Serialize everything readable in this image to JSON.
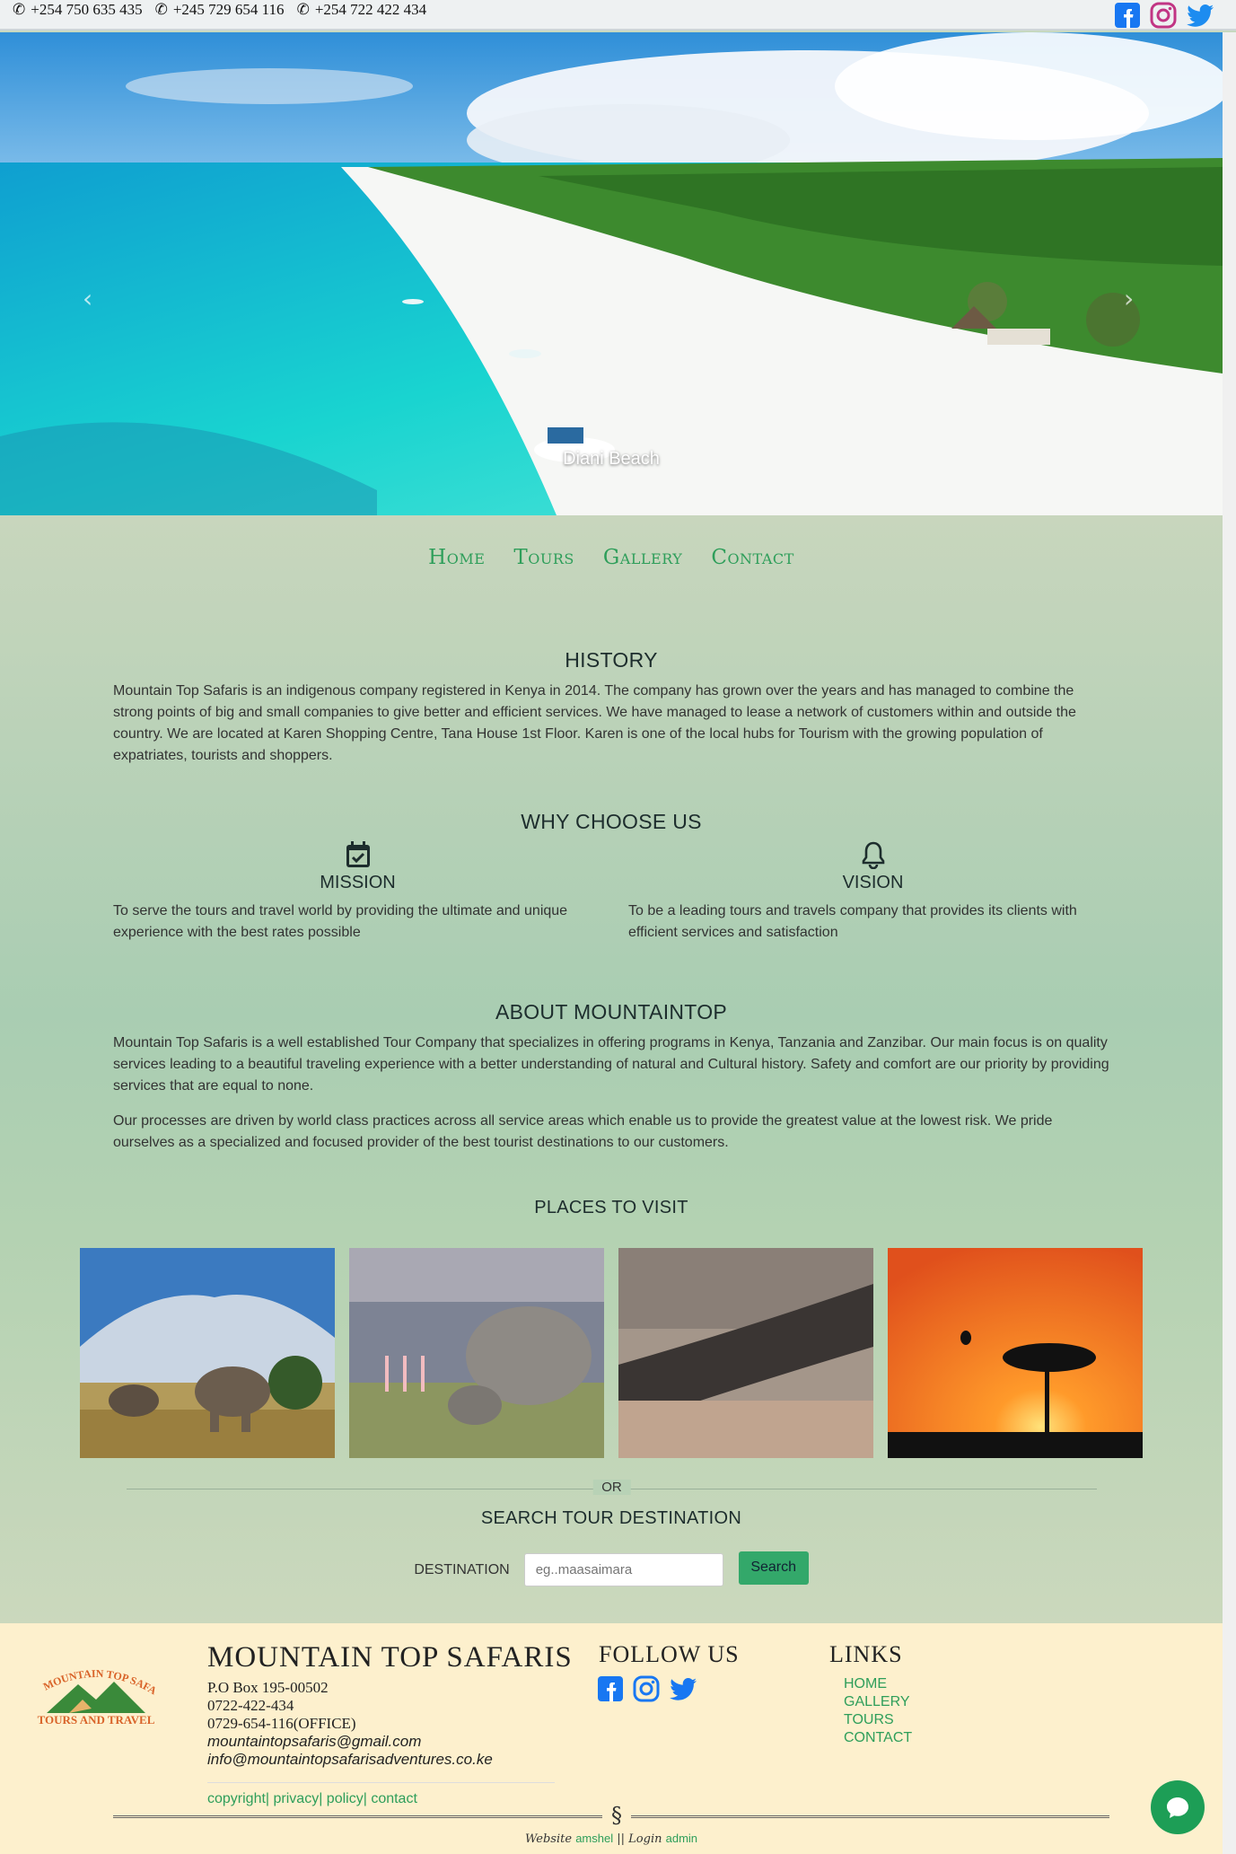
{
  "topbar": {
    "phones": [
      "+254 750 635 435",
      "+245 729 654 116",
      "+254 722 422 434"
    ],
    "social_icons": [
      "facebook-icon",
      "instagram-icon",
      "twitter-icon"
    ]
  },
  "hero": {
    "caption": "Diani Beach",
    "prev_label": "‹",
    "next_label": "›"
  },
  "nav": {
    "items": [
      "Home",
      "Tours",
      "Gallery",
      "Contact"
    ]
  },
  "history": {
    "title": "HISTORY",
    "text": "Mountain Top Safaris is an indigenous company registered in Kenya in 2014. The company has grown over the years and has managed to combine the strong points of big and small companies to give better and efficient services. We have managed to lease a network of customers within and outside the country. We are located at Karen Shopping Centre, Tana House 1st Floor. Karen is one of the local hubs for Tourism with the growing population of expatriates, tourists and shoppers."
  },
  "why": {
    "title": "WHY CHOOSE US",
    "mission_title": "MISSION",
    "mission_text": "To serve the tours and travel world by providing the ultimate and unique experience with the best rates possible",
    "vision_title": "VISION",
    "vision_text": "To be a leading tours and travels company that provides its clients with efficient services and satisfaction"
  },
  "about": {
    "title": "ABOUT MOUNTAINTOP",
    "p1": "Mountain Top Safaris is a well established Tour Company that specializes in offering programs in Kenya, Tanzania and Zanzibar. Our main focus is on quality services leading to a beautiful traveling experience with a better understanding of natural and Cultural history. Safety and comfort are our priority by providing services that are equal to none.",
    "p2": "Our processes are driven by world class practices across all service areas which enable us to provide the greatest value at the lowest risk. We pride ourselves as a specialized and focused provider of the best tourist destinations to our customers."
  },
  "places": {
    "title": "PLACES TO VISIT"
  },
  "search": {
    "or_label": "OR",
    "title": "SEARCH TOUR DESTINATION",
    "label": "DESTINATION",
    "placeholder": "eg..maasaimara",
    "button": "Search"
  },
  "footer": {
    "company": "MOUNTAIN TOP SAFARIS",
    "box": "P.O Box 195-00502",
    "phone1": "0722-422-434",
    "phone2": "0729-654-116(OFFICE)",
    "email1": "mountaintopsafaris@gmail.com",
    "email2": "info@mountaintopsafarisadventures.co.ke",
    "bottom_links": "copyright| privacy| policy| contact",
    "follow_title": "FOLLOW US",
    "links_title": "LINKS",
    "links": [
      "HOME",
      "GALLERY",
      "TOURS",
      "CONTACT"
    ],
    "divider_symbol": "§",
    "credit_website": "Website",
    "credit_author": "amshel",
    "credit_sep": "||",
    "credit_login": "Login",
    "credit_admin": "admin",
    "logo_text_top": "MOUNTAIN TOP SAFARIS",
    "logo_text_bottom": "TOURS AND TRAVEL"
  },
  "colors": {
    "accent": "#2e9e5a",
    "footer_bg": "#fdf0cd",
    "main_bg": "#b4d2b2",
    "facebook": "#1877f2",
    "instagram": "#c13584",
    "twitter": "#1da1f2"
  }
}
